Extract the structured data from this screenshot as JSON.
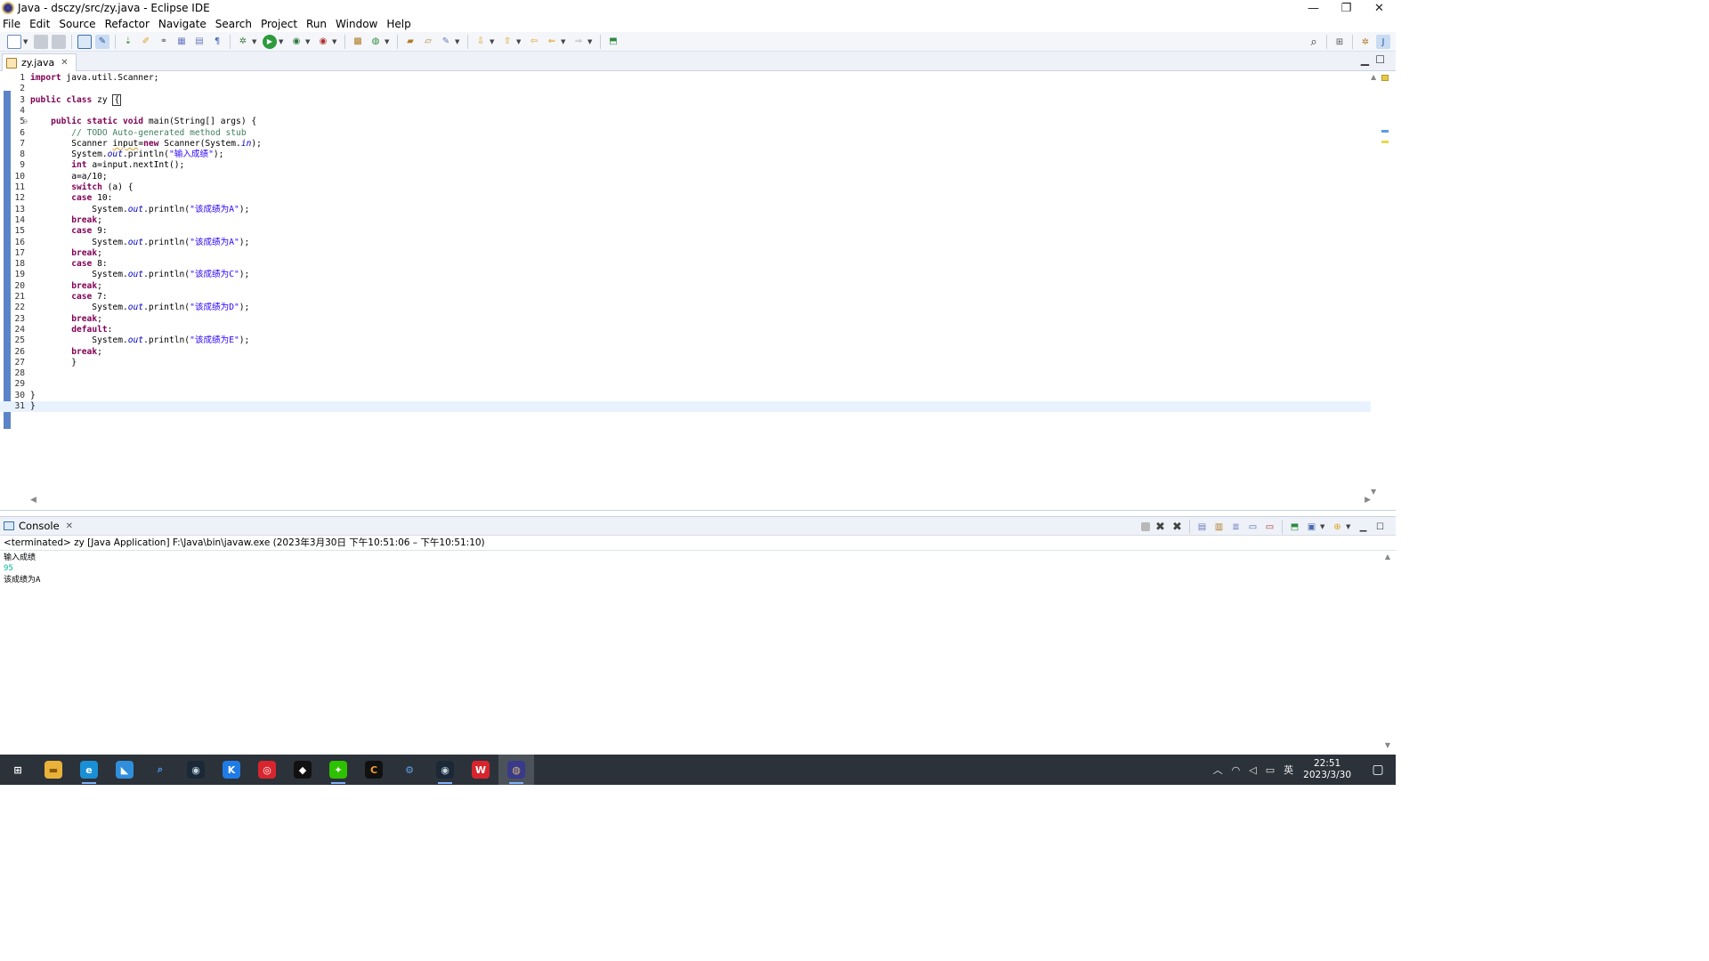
{
  "window": {
    "title": "Java - dsczy/src/zy.java - Eclipse IDE",
    "controls": [
      "—",
      "❐",
      "✕"
    ]
  },
  "menu": [
    "File",
    "Edit",
    "Source",
    "Refactor",
    "Navigate",
    "Search",
    "Project",
    "Run",
    "Window",
    "Help"
  ],
  "editor": {
    "tab_label": "zy.java",
    "lines": [
      {
        "n": "1",
        "html": "<span class=\"kw\">import</span> java.util.Scanner;"
      },
      {
        "n": "2",
        "html": ""
      },
      {
        "n": "3",
        "html": "<span class=\"kw\">public</span> <span class=\"kw\">class</span> zy <span style=\"border:1px solid #333;padding:0 1px\">{</span>"
      },
      {
        "n": "4",
        "html": ""
      },
      {
        "n": "5",
        "html": "    <span class=\"kw\">public</span> <span class=\"kw\">static</span> <span class=\"kw\">void</span> main(String[] args) {"
      },
      {
        "n": "6",
        "html": "        <span class=\"cmt\">// TODO Auto-generated method stub</span>"
      },
      {
        "n": "7",
        "html": "        Scanner <span style=\"text-decoration:underline wavy #e0a020\">input</span>=<span class=\"kw\">new</span> Scanner(System.<span class=\"fld\">in</span>);"
      },
      {
        "n": "8",
        "html": "        System.<span class=\"fld\">out</span>.println(<span class=\"str\">\"输入成绩\"</span>);"
      },
      {
        "n": "9",
        "html": "        <span class=\"kw\">int</span> a=input.nextInt();"
      },
      {
        "n": "10",
        "html": "        a=a/10;"
      },
      {
        "n": "11",
        "html": "        <span class=\"kw\">switch</span> (a) {"
      },
      {
        "n": "12",
        "html": "        <span class=\"kw\">case</span> 10:"
      },
      {
        "n": "13",
        "html": "            System.<span class=\"fld\">out</span>.println(<span class=\"str\">\"该成绩为A\"</span>);"
      },
      {
        "n": "14",
        "html": "        <span class=\"kw\">break</span>;"
      },
      {
        "n": "15",
        "html": "        <span class=\"kw\">case</span> 9:"
      },
      {
        "n": "16",
        "html": "            System.<span class=\"fld\">out</span>.println(<span class=\"str\">\"该成绩为A\"</span>);"
      },
      {
        "n": "17",
        "html": "        <span class=\"kw\">break</span>;"
      },
      {
        "n": "18",
        "html": "        <span class=\"kw\">case</span> 8:"
      },
      {
        "n": "19",
        "html": "            System.<span class=\"fld\">out</span>.println(<span class=\"str\">\"该成绩为C\"</span>);"
      },
      {
        "n": "20",
        "html": "        <span class=\"kw\">break</span>;"
      },
      {
        "n": "21",
        "html": "        <span class=\"kw\">case</span> 7:"
      },
      {
        "n": "22",
        "html": "            System.<span class=\"fld\">out</span>.println(<span class=\"str\">\"该成绩为D\"</span>);"
      },
      {
        "n": "23",
        "html": "        <span class=\"kw\">break</span>;"
      },
      {
        "n": "24",
        "html": "        <span class=\"kw\">default</span>:"
      },
      {
        "n": "25",
        "html": "            System.<span class=\"fld\">out</span>.println(<span class=\"str\">\"该成绩为E\"</span>);"
      },
      {
        "n": "26",
        "html": "        <span class=\"kw\">break</span>;"
      },
      {
        "n": "27",
        "html": "        }"
      },
      {
        "n": "28",
        "html": ""
      },
      {
        "n": "29",
        "html": ""
      },
      {
        "n": "30",
        "html": "}"
      },
      {
        "n": "31",
        "html": "}"
      }
    ],
    "current_line": "31"
  },
  "console": {
    "tab_label": "Console",
    "status": "<terminated> zy [Java Application] F:\\Java\\bin\\javaw.exe  (2023年3月30日 下午10:51:06 – 下午10:51:10)",
    "output": [
      {
        "text": "输入成绩",
        "kind": "out"
      },
      {
        "text": "95",
        "kind": "in"
      },
      {
        "text": "该成绩为A",
        "kind": "out"
      }
    ]
  },
  "taskbar": {
    "apps": [
      {
        "name": "windows-start-icon",
        "glyph": "⊞",
        "color": "#2c323a",
        "fg": "#ffffff"
      },
      {
        "name": "file-explorer-icon",
        "glyph": "▬",
        "color": "#e8b23a",
        "fg": "#8a5a00"
      },
      {
        "name": "edge-browser-icon",
        "glyph": "e",
        "color": "#1a8fd6",
        "fg": "#ffffff"
      },
      {
        "name": "photos-app-icon",
        "glyph": "◣",
        "color": "#2f8fdc",
        "fg": "#ffffff"
      },
      {
        "name": "search-app-icon",
        "glyph": "⌕",
        "color": "#2c323a",
        "fg": "#4aa3ff"
      },
      {
        "name": "steam-icon",
        "glyph": "◉",
        "color": "#1b2838",
        "fg": "#c7d5e0"
      },
      {
        "name": "kugou-music-icon",
        "glyph": "K",
        "color": "#1f7be6",
        "fg": "#ffffff"
      },
      {
        "name": "netease-music-icon",
        "glyph": "◎",
        "color": "#d8252d",
        "fg": "#ffffff"
      },
      {
        "name": "qq-icon",
        "glyph": "◆",
        "color": "#111111",
        "fg": "#ffffff"
      },
      {
        "name": "wechat-icon",
        "glyph": "✦",
        "color": "#2dc100",
        "fg": "#ffffff"
      },
      {
        "name": "generic-c-app-icon",
        "glyph": "C",
        "color": "#111111",
        "fg": "#f0a030"
      },
      {
        "name": "settings-gear-icon",
        "glyph": "⚙",
        "color": "#2c323a",
        "fg": "#5aa0e8"
      },
      {
        "name": "steam-running-icon",
        "glyph": "◉",
        "color": "#1b2838",
        "fg": "#c7d5e0"
      },
      {
        "name": "wps-office-icon",
        "glyph": "W",
        "color": "#d8252d",
        "fg": "#ffffff"
      },
      {
        "name": "eclipse-ide-icon",
        "glyph": "◍",
        "color": "#3a3a8a",
        "fg": "#d9b86e"
      }
    ],
    "tray_lang": "英",
    "time": "22:51",
    "date": "2023/3/30"
  }
}
